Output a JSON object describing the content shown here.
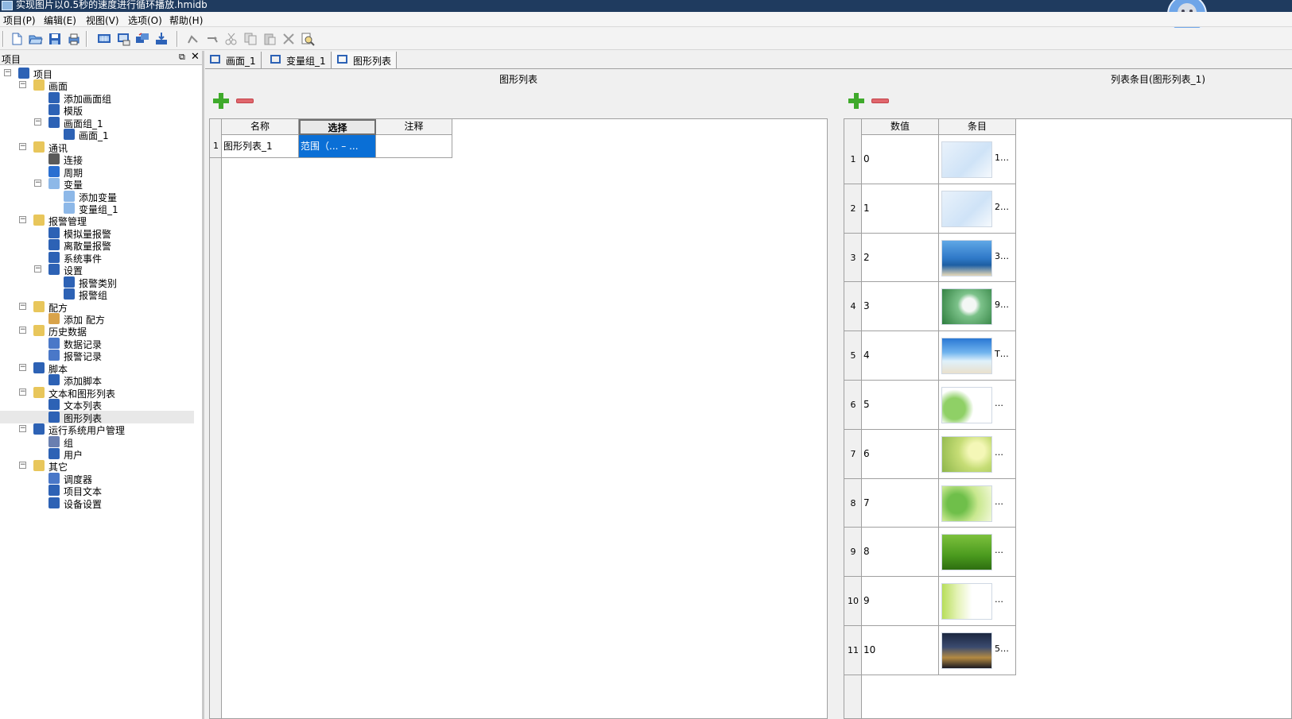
{
  "window": {
    "title": "实现图片以0.5秒的速度进行循环播放.hmidb"
  },
  "menu": [
    "项目(P)",
    "编辑(E)",
    "视图(V)",
    "选项(O)",
    "帮助(H)"
  ],
  "toolbar_icons": [
    "new-file-icon",
    "open-folder-icon",
    "save-icon",
    "print-icon",
    "screen-icon",
    "compile-icon",
    "transfer-icon",
    "download-icon",
    "undo-icon",
    "redo-icon",
    "cut-icon",
    "copy-icon",
    "paste-icon",
    "delete-icon",
    "find-icon"
  ],
  "project_panel": {
    "title": "项目",
    "tree": [
      {
        "label": "项目",
        "level": 0,
        "expander": "⊟",
        "icon": "project-icon",
        "color": "#2d62b5"
      },
      {
        "label": "画面",
        "level": 1,
        "expander": "⊟",
        "icon": "folder-screens-icon",
        "color": "#e8c65b"
      },
      {
        "label": "添加画面组",
        "level": 2,
        "icon": "add-screen-group-icon",
        "color": "#2d62b5"
      },
      {
        "label": "模版",
        "level": 2,
        "icon": "template-icon",
        "color": "#2d62b5"
      },
      {
        "label": "画面组_1",
        "level": 2,
        "expander": "⊟",
        "icon": "screen-group-icon",
        "color": "#2d62b5"
      },
      {
        "label": "画面_1",
        "level": 3,
        "icon": "screen-icon",
        "color": "#2d62b5"
      },
      {
        "label": "通讯",
        "level": 1,
        "expander": "⊟",
        "icon": "folder-comm-icon",
        "color": "#e8c65b"
      },
      {
        "label": "连接",
        "level": 2,
        "icon": "connection-icon",
        "color": "#5a5a5a"
      },
      {
        "label": "周期",
        "level": 2,
        "icon": "cycle-icon",
        "color": "#2a6fd1"
      },
      {
        "label": "变量",
        "level": 2,
        "expander": "⊟",
        "icon": "variable-icon",
        "color": "#8db8e8"
      },
      {
        "label": "添加变量",
        "level": 3,
        "icon": "add-variable-icon",
        "color": "#8db8e8"
      },
      {
        "label": "变量组_1",
        "level": 3,
        "icon": "variable-group-icon",
        "color": "#8db8e8"
      },
      {
        "label": "报警管理",
        "level": 1,
        "expander": "⊟",
        "icon": "folder-alarm-icon",
        "color": "#e8c65b"
      },
      {
        "label": "模拟量报警",
        "level": 2,
        "icon": "analog-alarm-icon",
        "color": "#2d62b5"
      },
      {
        "label": "离散量报警",
        "level": 2,
        "icon": "discrete-alarm-icon",
        "color": "#2d62b5"
      },
      {
        "label": "系统事件",
        "level": 2,
        "icon": "system-event-icon",
        "color": "#2d62b5"
      },
      {
        "label": "设置",
        "level": 2,
        "expander": "⊟",
        "icon": "alarm-settings-icon",
        "color": "#2d62b5"
      },
      {
        "label": "报警类别",
        "level": 3,
        "icon": "alarm-class-icon",
        "color": "#2d62b5"
      },
      {
        "label": "报警组",
        "level": 3,
        "icon": "alarm-group-icon",
        "color": "#2d62b5"
      },
      {
        "label": "配方",
        "level": 1,
        "expander": "⊟",
        "icon": "folder-recipe-icon",
        "color": "#e8c65b"
      },
      {
        "label": "添加 配方",
        "level": 2,
        "icon": "add-recipe-icon",
        "color": "#d9a34a"
      },
      {
        "label": "历史数据",
        "level": 1,
        "expander": "⊟",
        "icon": "folder-history-icon",
        "color": "#e8c65b"
      },
      {
        "label": "数据记录",
        "level": 2,
        "icon": "data-log-icon",
        "color": "#4a78c8"
      },
      {
        "label": "报警记录",
        "level": 2,
        "icon": "alarm-log-icon",
        "color": "#4a78c8"
      },
      {
        "label": "脚本",
        "level": 1,
        "expander": "⊟",
        "icon": "folder-script-icon",
        "color": "#2d62b5"
      },
      {
        "label": "添加脚本",
        "level": 2,
        "icon": "add-script-icon",
        "color": "#2d62b5"
      },
      {
        "label": "文本和图形列表",
        "level": 1,
        "expander": "⊟",
        "icon": "folder-lists-icon",
        "color": "#e8c65b"
      },
      {
        "label": "文本列表",
        "level": 2,
        "icon": "text-list-icon",
        "color": "#2d62b5"
      },
      {
        "label": "图形列表",
        "level": 2,
        "icon": "graphic-list-icon",
        "color": "#2d62b5",
        "selected": true
      },
      {
        "label": "运行系统用户管理",
        "level": 1,
        "expander": "⊟",
        "icon": "user-admin-icon",
        "color": "#2d62b5"
      },
      {
        "label": "组",
        "level": 2,
        "icon": "group-icon",
        "color": "#6a7fb0"
      },
      {
        "label": "用户",
        "level": 2,
        "icon": "user-icon",
        "color": "#2d62b5"
      },
      {
        "label": "其它",
        "level": 1,
        "expander": "⊟",
        "icon": "folder-other-icon",
        "color": "#e8c65b"
      },
      {
        "label": "调度器",
        "level": 2,
        "icon": "scheduler-icon",
        "color": "#4a78c8"
      },
      {
        "label": "项目文本",
        "level": 2,
        "icon": "project-text-icon",
        "color": "#2d62b5"
      },
      {
        "label": "设备设置",
        "level": 2,
        "icon": "device-settings-icon",
        "color": "#2d62b5"
      }
    ]
  },
  "tabs": [
    {
      "label": "画面_1",
      "icon": "screen-icon"
    },
    {
      "label": "变量组_1",
      "icon": "variable-group-icon"
    },
    {
      "label": "图形列表",
      "icon": "graphic-list-icon",
      "active": true
    }
  ],
  "graphic_list": {
    "title": "图形列表",
    "columns": [
      "名称",
      "选择",
      "注释"
    ],
    "rows": [
      {
        "num": "1",
        "name": "图形列表_1",
        "selection": "范围（... – ...",
        "comment": ""
      }
    ]
  },
  "list_entries": {
    "title": "列表条目(图形列表_1)",
    "columns": [
      "数值",
      "条目"
    ],
    "rows": [
      {
        "num": "1",
        "value": "0",
        "label": "1…",
        "image": "balloon-sketch"
      },
      {
        "num": "2",
        "value": "1",
        "label": "2…",
        "image": "balloon-sketch"
      },
      {
        "num": "3",
        "value": "2",
        "label": "3…",
        "image": "sea"
      },
      {
        "num": "4",
        "value": "3",
        "label": "9…",
        "image": "lotus"
      },
      {
        "num": "5",
        "value": "4",
        "label": "T…",
        "image": "beach"
      },
      {
        "num": "6",
        "value": "5",
        "label": "…",
        "image": "leaf-white"
      },
      {
        "num": "7",
        "value": "6",
        "label": "…",
        "image": "green-bokeh"
      },
      {
        "num": "8",
        "value": "7",
        "label": "…",
        "image": "clover"
      },
      {
        "num": "9",
        "value": "8",
        "label": "…",
        "image": "green-grass"
      },
      {
        "num": "10",
        "value": "9",
        "label": "…",
        "image": "green-drop"
      },
      {
        "num": "11",
        "value": "10",
        "label": "5…",
        "image": "city-night"
      }
    ]
  }
}
